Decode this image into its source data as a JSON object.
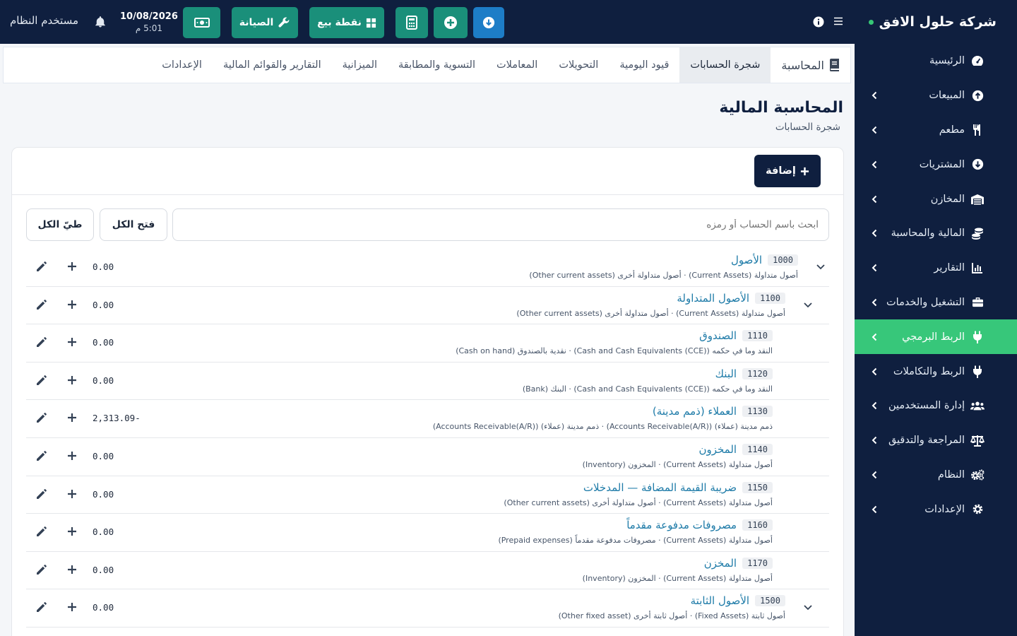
{
  "brand": {
    "name": "شركة حلول الافق"
  },
  "topbar": {
    "user": "مستخدم النظام",
    "date": "10/08/2026",
    "time": "5:01 م",
    "maintenance": "الصيانة",
    "pos": "نقطة بيع"
  },
  "sidebar": {
    "items": [
      {
        "label": "الرئيسية"
      },
      {
        "label": "المبيعات"
      },
      {
        "label": "مطعم"
      },
      {
        "label": "المشتريات"
      },
      {
        "label": "المخازن"
      },
      {
        "label": "المالية والمحاسبة"
      },
      {
        "label": "التقارير"
      },
      {
        "label": "التشغيل والخدمات"
      },
      {
        "label": "الربط البرمجي"
      },
      {
        "label": "الربط والتكاملات"
      },
      {
        "label": "إدارة المستخدمين"
      },
      {
        "label": "المراجعة والتدقيق"
      },
      {
        "label": "النظام"
      },
      {
        "label": "الإعدادات"
      }
    ]
  },
  "tabs": [
    {
      "label": "المحاسبة"
    },
    {
      "label": "شجرة الحسابات"
    },
    {
      "label": "قيود اليومية"
    },
    {
      "label": "التحويلات"
    },
    {
      "label": "المعاملات"
    },
    {
      "label": "التسوية والمطابقة"
    },
    {
      "label": "الميزانية"
    },
    {
      "label": "التقارير والقوائم المالية"
    },
    {
      "label": "الإعدادات"
    }
  ],
  "page": {
    "title": "المحاسبة المالية",
    "subtitle": "شجرة الحسابات"
  },
  "card": {
    "add_label": "إضافة",
    "search_placeholder": "ابحث باسم الحساب أو رمزه",
    "expand_all": "فتح الكل",
    "collapse_all": "طيّ الكل"
  },
  "accounts": [
    {
      "code": "1000",
      "name": "الأصول",
      "desc": "أصول متداولة (Current Assets) · أصول متداولة أخرى (Other current assets)",
      "balance": "0.00"
    },
    {
      "code": "1100",
      "name": "الأصول المتداولة",
      "desc": "أصول متداولة (Current Assets) · أصول متداولة أخرى (Other current assets)",
      "balance": "0.00"
    },
    {
      "code": "1110",
      "name": "الصندوق",
      "desc": "النقد وما في حكمه (Cash and Cash Equivalents (CCE)) · نقدية بالصندوق (Cash on hand)",
      "balance": "0.00"
    },
    {
      "code": "1120",
      "name": "البنك",
      "desc": "النقد وما في حكمه (Cash and Cash Equivalents (CCE)) · البنك (Bank)",
      "balance": "0.00"
    },
    {
      "code": "1130",
      "name": "العملاء (ذمم مدينة)",
      "desc": "ذمم مدينة (عملاء) (Accounts Receivable(A/R)) · ذمم مدينة (عملاء) (Accounts Receivable(A/R))",
      "balance": "2,313.09-"
    },
    {
      "code": "1140",
      "name": "المخزون",
      "desc": "أصول متداولة (Current Assets) · المخزون (Inventory)",
      "balance": "0.00"
    },
    {
      "code": "1150",
      "name": "ضريبة القيمة المضافة — المدخلات",
      "desc": "أصول متداولة (Current Assets) · أصول متداولة أخرى (Other current assets)",
      "balance": "0.00"
    },
    {
      "code": "1160",
      "name": "مصروفات مدفوعة مقدماً",
      "desc": "أصول متداولة (Current Assets) · مصروفات مدفوعة مقدماً (Prepaid expenses)",
      "balance": "0.00"
    },
    {
      "code": "1170",
      "name": "المخزن",
      "desc": "أصول متداولة (Current Assets) · المخزون (Inventory)",
      "balance": "0.00"
    },
    {
      "code": "1500",
      "name": "الأصول الثابتة",
      "desc": "أصول ثابتة (Fixed Assets) · أصول ثابتة أخرى (Other fixed asset)",
      "balance": "0.00"
    }
  ],
  "colors": {
    "navy": "#0f1f3f",
    "green": "#37c77a",
    "teal": "#1a8f7a",
    "blue": "#1d7dc7",
    "link": "#1e7ba8"
  }
}
